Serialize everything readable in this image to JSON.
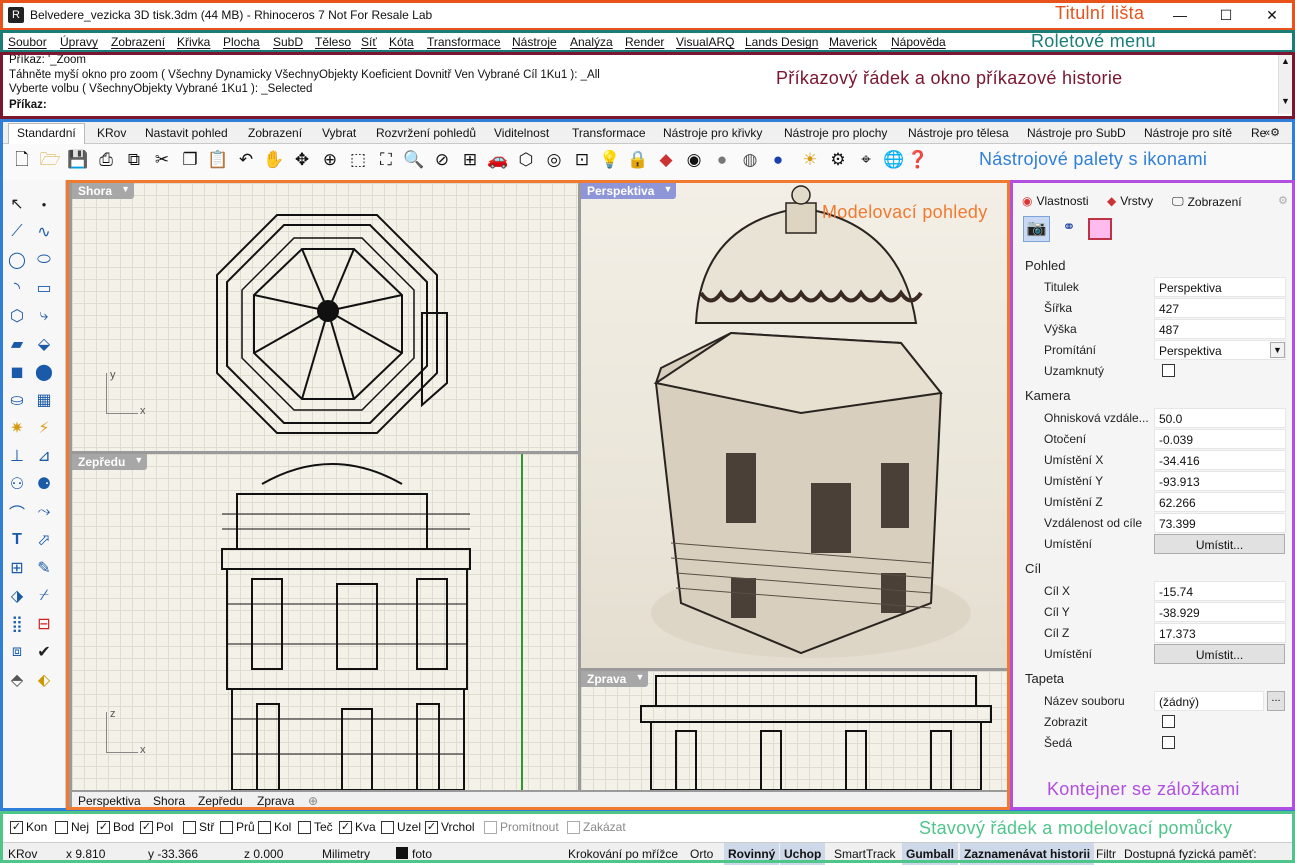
{
  "window": {
    "title": "Belvedere_vezicka 3D tisk.3dm (44 MB) - Rhinoceros 7 Not For Resale Lab",
    "min": "—",
    "max": "☐",
    "close": "✕"
  },
  "menu": [
    "Soubor",
    "Úpravy",
    "Zobrazení",
    "Křivka",
    "Plocha",
    "SubD",
    "Těleso",
    "Síť",
    "Kóta",
    "Transformace",
    "Nástroje",
    "Analýza",
    "Render",
    "VisualARQ",
    "Lands Design",
    "Maverick",
    "Nápověda"
  ],
  "command": {
    "history": [
      "Příkaz: '_Zoom",
      "Táhněte myší okno pro zoom ( Všechny  Dynamicky  VšechnyObjekty  Koeficient  Dovnitř  Ven  Vybrané  Cíl  1Ku1 ): _All",
      "Vyberte volbu ( VšechnyObjekty  Vybrané  1Ku1 ): _Selected"
    ],
    "prompt": "Příkaz:"
  },
  "toolbar_tabs": [
    "Standardní",
    "KRov",
    "Nastavit pohled",
    "Zobrazení",
    "Vybrat",
    "Rozvržení pohledů",
    "Viditelnost",
    "Transformace",
    "Nástroje pro křivky",
    "Nástroje pro plochy",
    "Nástroje pro tělesa",
    "Nástroje pro SubD",
    "Nástroje pro sítě",
    "Re"
  ],
  "viewports": {
    "top": {
      "title": "Shora",
      "ax1": "y",
      "ax2": "x"
    },
    "front": {
      "title": "Zepředu",
      "ax1": "z",
      "ax2": "x"
    },
    "persp": {
      "title": "Perspektiva"
    },
    "right": {
      "title": "Zprava"
    },
    "tabs": [
      "Perspektiva",
      "Shora",
      "Zepředu",
      "Zprava",
      "⊕"
    ]
  },
  "panel": {
    "tabs": [
      "Vlastnosti",
      "Vrstvy",
      "Zobrazení"
    ],
    "sections": {
      "view": "Pohled",
      "camera": "Kamera",
      "target": "Cíl",
      "wallpaper": "Tapeta"
    },
    "view": [
      [
        "Titulek",
        "Perspektiva"
      ],
      [
        "Šířka",
        "427"
      ],
      [
        "Výška",
        "487"
      ],
      [
        "Promítání",
        "Perspektiva"
      ],
      [
        "Uzamknutý",
        ""
      ]
    ],
    "camera": [
      [
        "Ohnisková vzdále...",
        "50.0"
      ],
      [
        "Otočení",
        "-0.039"
      ],
      [
        "Umístění X",
        "-34.416"
      ],
      [
        "Umístění Y",
        "-93.913"
      ],
      [
        "Umístění Z",
        "62.266"
      ],
      [
        "Vzdálenost od cíle",
        "73.399"
      ],
      [
        "Umístění",
        "Umístit..."
      ]
    ],
    "target": [
      [
        "Cíl X",
        "-15.74"
      ],
      [
        "Cíl Y",
        "-38.929"
      ],
      [
        "Cíl Z",
        "17.373"
      ],
      [
        "Umístění",
        "Umístit..."
      ]
    ],
    "wallpaper": [
      [
        "Název souboru",
        "(žádný)"
      ],
      [
        "Zobrazit",
        ""
      ],
      [
        "Šedá",
        ""
      ]
    ],
    "browse": "..."
  },
  "osnaps": [
    [
      "Kon",
      true
    ],
    [
      "Nej",
      false
    ],
    [
      "Bod",
      true
    ],
    [
      "Pol",
      true
    ],
    [
      "Stř",
      false
    ],
    [
      "Prů",
      false
    ],
    [
      "Kol",
      false
    ],
    [
      "Teč",
      false
    ],
    [
      "Kva",
      true
    ],
    [
      "Uzel",
      false
    ],
    [
      "Vrchol",
      true
    ],
    [
      "Promítnout",
      false
    ],
    [
      "Zakázat",
      false
    ]
  ],
  "status": {
    "layer": "KRov",
    "x": "x 9.810",
    "y": "y -33.366",
    "z": "z 0.000",
    "units": "Milimetry",
    "layer_name": "foto",
    "items": [
      "Krokování po mřížce",
      "Orto",
      "Rovinný",
      "Uchop",
      "SmartTrack",
      "Gumball",
      "Zaznamenávat historii",
      "Filtr",
      "Dostupná fyzická paměť:"
    ]
  },
  "labels": {
    "title": "Titulní lišta",
    "menu": "Roletové menu",
    "cmd": "Příkazový řádek a okno příkazové historie",
    "toolbar": "Nástrojové palety s ikonami",
    "viewports": "Modelovací pohledy",
    "panel": "Kontejner se záložkami",
    "status": "Stavový řádek a modelovací pomůcky"
  },
  "colors": {
    "title": "#e8531c",
    "menu": "#1a7d78",
    "cmd": "#7a1630",
    "toolbar": "#2f7fd8",
    "viewports": "#f07a30",
    "panel": "#b04fe0",
    "status": "#4fc58a"
  },
  "icons": [
    "new-icon",
    "open-icon",
    "save-icon",
    "print-icon",
    "import-icon",
    "cut-icon",
    "copy-icon",
    "paste-icon",
    "undo-icon",
    "pan-icon",
    "rotate-icon",
    "zoom-icon",
    "zoom-window-icon",
    "zoom-extents-icon",
    "zoom-selected-icon",
    "tilt-icon",
    "viewport-layout-icon",
    "car-icon",
    "object-display-icon",
    "camera-icon",
    "grid-icon",
    "light-icon",
    "lock-icon",
    "layer-icon",
    "color-icon",
    "shaded-icon",
    "render-icon",
    "sun-icon",
    "macro-icon",
    "gumball-icon",
    "help-icon"
  ]
}
